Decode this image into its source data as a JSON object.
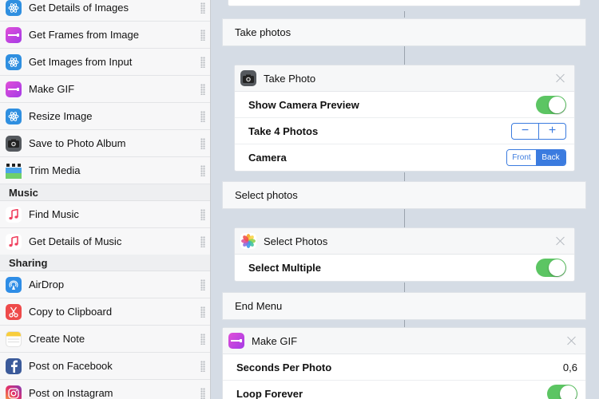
{
  "sidebar": {
    "items": [
      {
        "label": "Get Details of Images",
        "icon": "atom-icon"
      },
      {
        "label": "Get Frames from Image",
        "icon": "gif-icon"
      },
      {
        "label": "Get Images from Input",
        "icon": "atom-icon"
      },
      {
        "label": "Make GIF",
        "icon": "gif-icon"
      },
      {
        "label": "Resize Image",
        "icon": "atom-icon"
      },
      {
        "label": "Save to Photo Album",
        "icon": "camera-icon"
      },
      {
        "label": "Trim Media",
        "icon": "clapper-icon"
      }
    ],
    "music_header": "Music",
    "music_items": [
      {
        "label": "Find Music",
        "icon": "music-note-icon"
      },
      {
        "label": "Get Details of Music",
        "icon": "music-note-icon"
      }
    ],
    "sharing_header": "Sharing",
    "sharing_items": [
      {
        "label": "AirDrop",
        "icon": "airdrop-icon"
      },
      {
        "label": "Copy to Clipboard",
        "icon": "scissors-icon"
      },
      {
        "label": "Create Note",
        "icon": "notes-icon"
      },
      {
        "label": "Post on Facebook",
        "icon": "facebook-icon"
      },
      {
        "label": "Post on Instagram",
        "icon": "instagram-icon"
      }
    ]
  },
  "workflow": {
    "menu_take_photos": "Take photos",
    "take_photo": {
      "title": "Take Photo",
      "show_preview_label": "Show Camera Preview",
      "show_preview_value": true,
      "take_count_label": "Take 4 Photos",
      "stepper_minus": "−",
      "stepper_plus": "+",
      "camera_label": "Camera",
      "camera_options": [
        "Front",
        "Back"
      ],
      "camera_selected": "Back"
    },
    "menu_select_photos": "Select photos",
    "select_photos": {
      "title": "Select Photos",
      "multiple_label": "Select Multiple",
      "multiple_value": true
    },
    "menu_end": "End Menu",
    "make_gif": {
      "title": "Make GIF",
      "seconds_label": "Seconds Per Photo",
      "seconds_value": "0,6",
      "loop_label": "Loop Forever",
      "loop_value": true
    }
  },
  "colors": {
    "accent": "#3b7bdf",
    "toggle_on": "#5cc563",
    "gif_icon": "#c53fe0",
    "atom_icon": "#2f8fe0"
  }
}
